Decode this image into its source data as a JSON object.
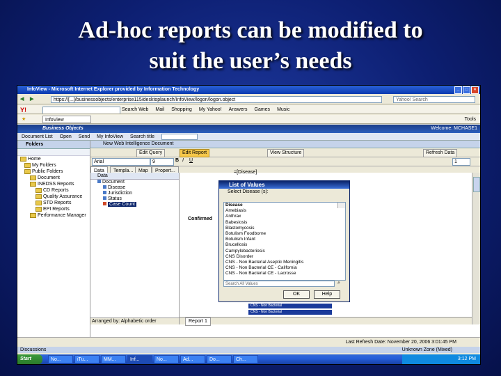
{
  "slide": {
    "title_line1": "Ad-hoc reports can be modified to",
    "title_line2": "suit the user’s needs"
  },
  "browser": {
    "window_title": "InfoView - Microsoft Internet Explorer provided by Information Technology",
    "address": "https://[...]/businessobjects/enterprise115/desktoplaunch/InfoView/logon/logon.object",
    "search_placeholder": "Yahoo! Search",
    "yahoo_logo": "Y!",
    "yahoo_items": [
      "Search Web",
      "Mail",
      "Shopping",
      "My Yahoo!",
      "Answers",
      "Games",
      "Music"
    ],
    "tab_label": "InfoView",
    "tools_label": "Tools"
  },
  "bo": {
    "logo": "Business Objects",
    "welcome": "Welcome: MCHASE1",
    "nav": [
      "Document List",
      "Open",
      "Send",
      "My InfoView",
      "Search title"
    ]
  },
  "folders": {
    "header": "Folders",
    "tree": [
      "Home",
      "My Folders",
      "Public Folders",
      "Document",
      "INEDSS Reports",
      "CD Reports",
      "Quality Assurance",
      "STD Reports",
      "EPI Reports",
      "Performance Manager"
    ]
  },
  "webi": {
    "header": "New Web Intelligence Document",
    "edit_query": "Edit Query",
    "edit_report": "Edit Report",
    "view_structure": "View Structure",
    "refresh": "Refresh Data",
    "font": "Arial",
    "size": "9",
    "page": "1",
    "subtabs": [
      "Data",
      "Templa...",
      "Map",
      "Propert..."
    ],
    "data_header": "Data",
    "data_tree": [
      "Document",
      "Disease",
      "Jurisdiction",
      "Status",
      "Case Count"
    ],
    "arranged_by": "Arranged by:  Alphabetic order",
    "report_tab": "Report 1",
    "confirmed": "Confirmed",
    "disease_formula": "=[Disease]",
    "cns_cells": [
      "CNS - Non Bacterial",
      "CNS - Non Bacterial"
    ]
  },
  "dialog": {
    "title": "List of Values",
    "prompt": "Select Disease (s):",
    "items": [
      "Disease",
      "Amebiasis",
      "Anthrax",
      "Babesiosis",
      "Blastomycosis",
      "Botulism Foodborne",
      "Botulism Infant",
      "Brucellosis",
      "Campylobacteriosis",
      "CNS Disorder",
      "CNS - Non Bacterial Aseptic Meningitis",
      "CNS - Non Bacterial CE - California",
      "CNS - Non Bacterial CE - Lacrosse"
    ],
    "search_placeholder": "Search All Values",
    "ok": "OK",
    "help": "Help"
  },
  "status": {
    "last_refresh": "Last Refresh Date: November 20, 2006 3:01:45 PM",
    "discussions": "Discussions",
    "zone": "Unknown Zone (Mixed)"
  },
  "taskbar": {
    "start": "Start",
    "tasks": [
      "No...",
      "iTu...",
      "MM...",
      "Inf...",
      "No...",
      "Ad...",
      "Do...",
      "Ch..."
    ],
    "clock": "3:12 PM"
  }
}
